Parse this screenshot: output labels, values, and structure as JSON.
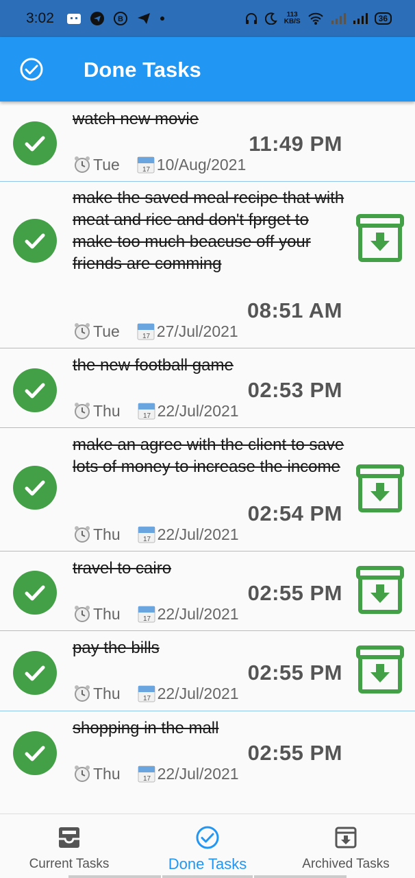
{
  "status_bar": {
    "time": "3:02",
    "net_speed_value": "113",
    "net_speed_unit": "KB/S",
    "battery": "36"
  },
  "app_bar": {
    "title": "Done Tasks",
    "icon": "check-circle-icon"
  },
  "colors": {
    "primary": "#2196f3",
    "done_green": "#43a047",
    "divider": "#90c5ec",
    "status_bar": "#2c6fb8"
  },
  "tasks": [
    {
      "title": "watch new movie",
      "time": "11:49 PM",
      "day": "Tue",
      "date": "10/Aug/2021",
      "archive": false
    },
    {
      "title": "make the saved meal recipe that with meat and rice and don't fprget to make too much beacuse off your friends are comming",
      "time": "08:51 AM",
      "day": "Tue",
      "date": "27/Jul/2021",
      "archive": true
    },
    {
      "title": "the new football game",
      "time": "02:53 PM",
      "day": "Thu",
      "date": "22/Jul/2021",
      "archive": false
    },
    {
      "title": "make an agree with the client to save lots of money to increase the income",
      "time": "02:54 PM",
      "day": "Thu",
      "date": "22/Jul/2021",
      "archive": true
    },
    {
      "title": "travel to cairo",
      "time": "02:55 PM",
      "day": "Thu",
      "date": "22/Jul/2021",
      "archive": true
    },
    {
      "title": "pay the bills",
      "time": "02:55 PM",
      "day": "Thu",
      "date": "22/Jul/2021",
      "archive": true
    },
    {
      "title": "shopping in the mall",
      "time": "02:55 PM",
      "day": "Thu",
      "date": "22/Jul/2021",
      "archive": false
    }
  ],
  "bottom_nav": {
    "items": [
      {
        "label": "Current Tasks",
        "icon": "inbox-icon",
        "active": false
      },
      {
        "label": "Done Tasks",
        "icon": "check-circle-icon",
        "active": true
      },
      {
        "label": "Archived Tasks",
        "icon": "archive-icon",
        "active": false
      }
    ]
  }
}
